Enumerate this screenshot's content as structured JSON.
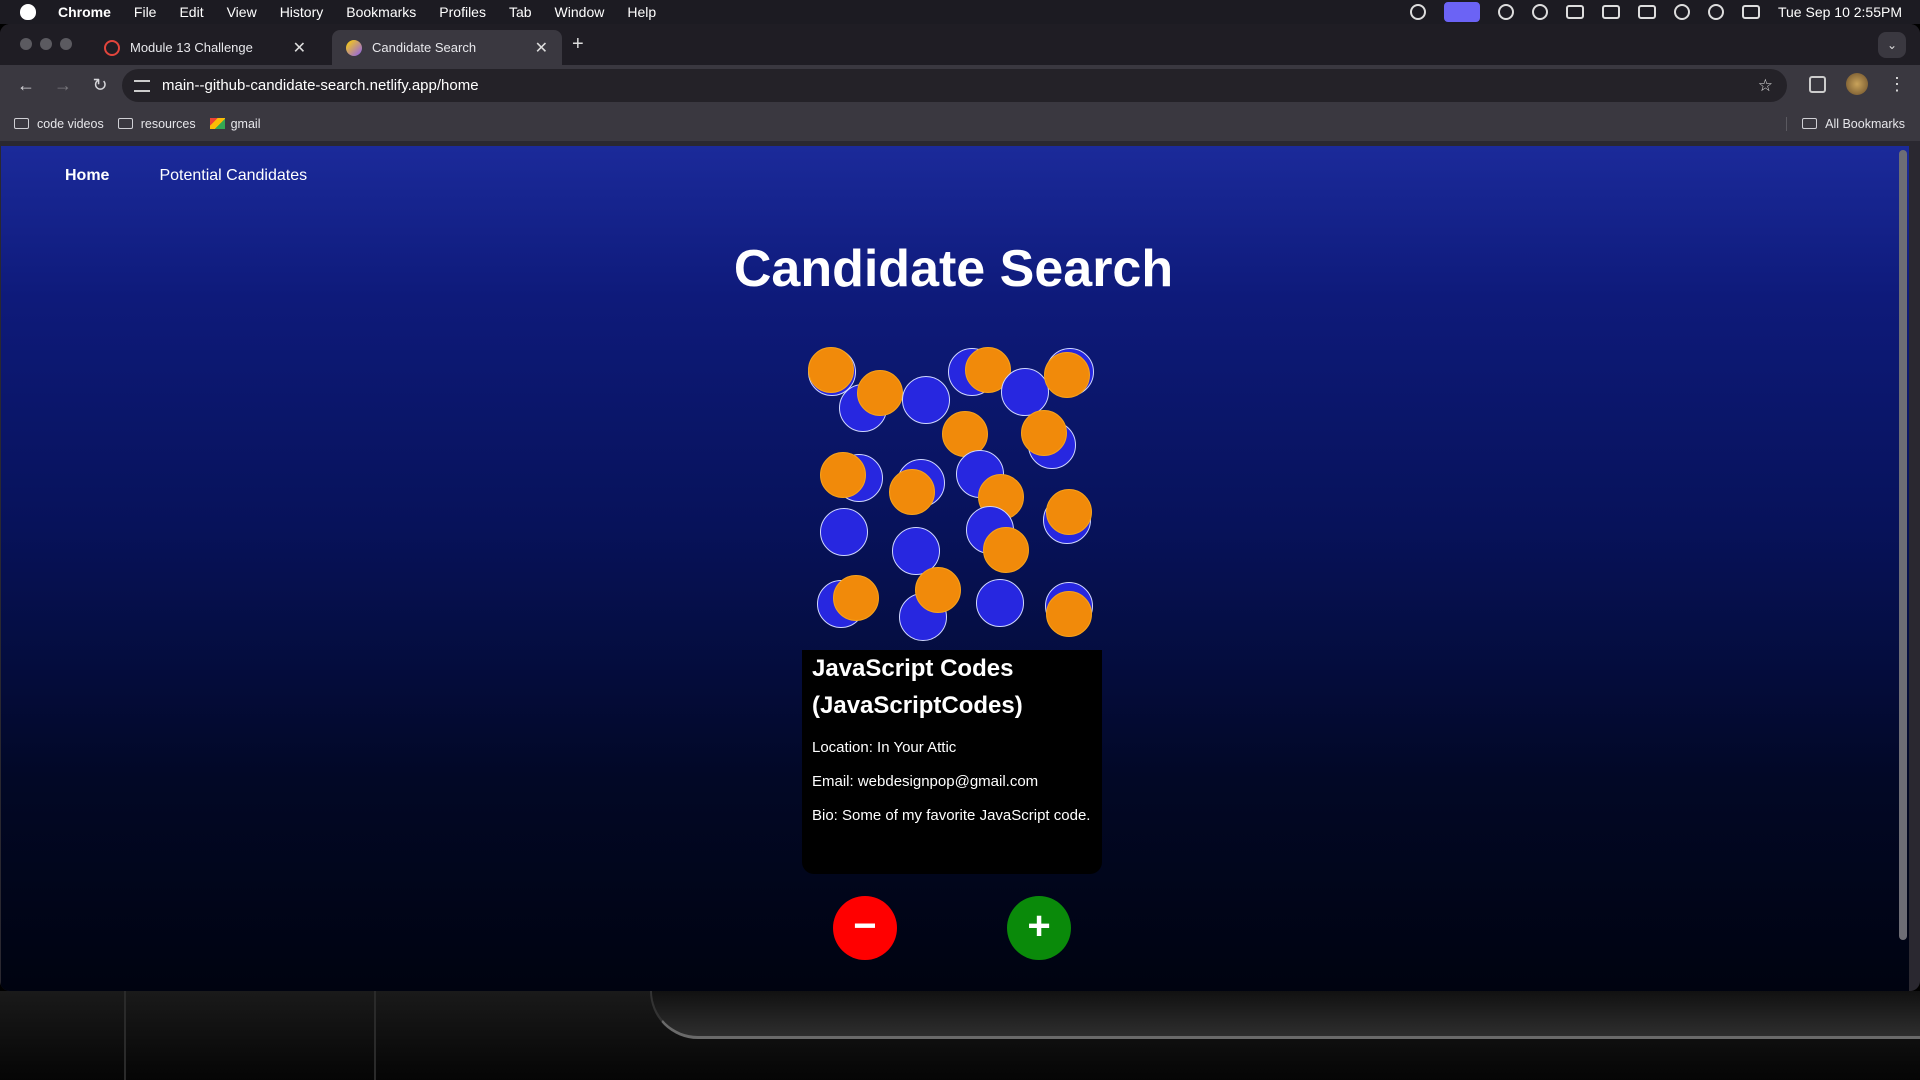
{
  "menubar": {
    "app": "Chrome",
    "items": [
      "File",
      "Edit",
      "View",
      "History",
      "Bookmarks",
      "Profiles",
      "Tab",
      "Window",
      "Help"
    ],
    "clock": "Tue Sep 10  2:55PM"
  },
  "browser": {
    "tabs": [
      {
        "title": "Module 13 Challenge"
      },
      {
        "title": "Candidate Search"
      }
    ],
    "url": "main--github-candidate-search.netlify.app/home",
    "bookmarks": [
      "code videos",
      "resources",
      "gmail"
    ],
    "all_bookmarks": "All Bookmarks"
  },
  "site": {
    "nav": {
      "home": "Home",
      "potential": "Potential Candidates"
    },
    "title": "Candidate Search",
    "candidate": {
      "name": "JavaScript Codes (JavaScriptCodes)",
      "location": "Location: In Your Attic",
      "email": "Email: webdesignpop@gmail.com",
      "bio": "Bio: Some of my favorite JavaScript code."
    },
    "reject_symbol": "−",
    "accept_symbol": "+"
  }
}
